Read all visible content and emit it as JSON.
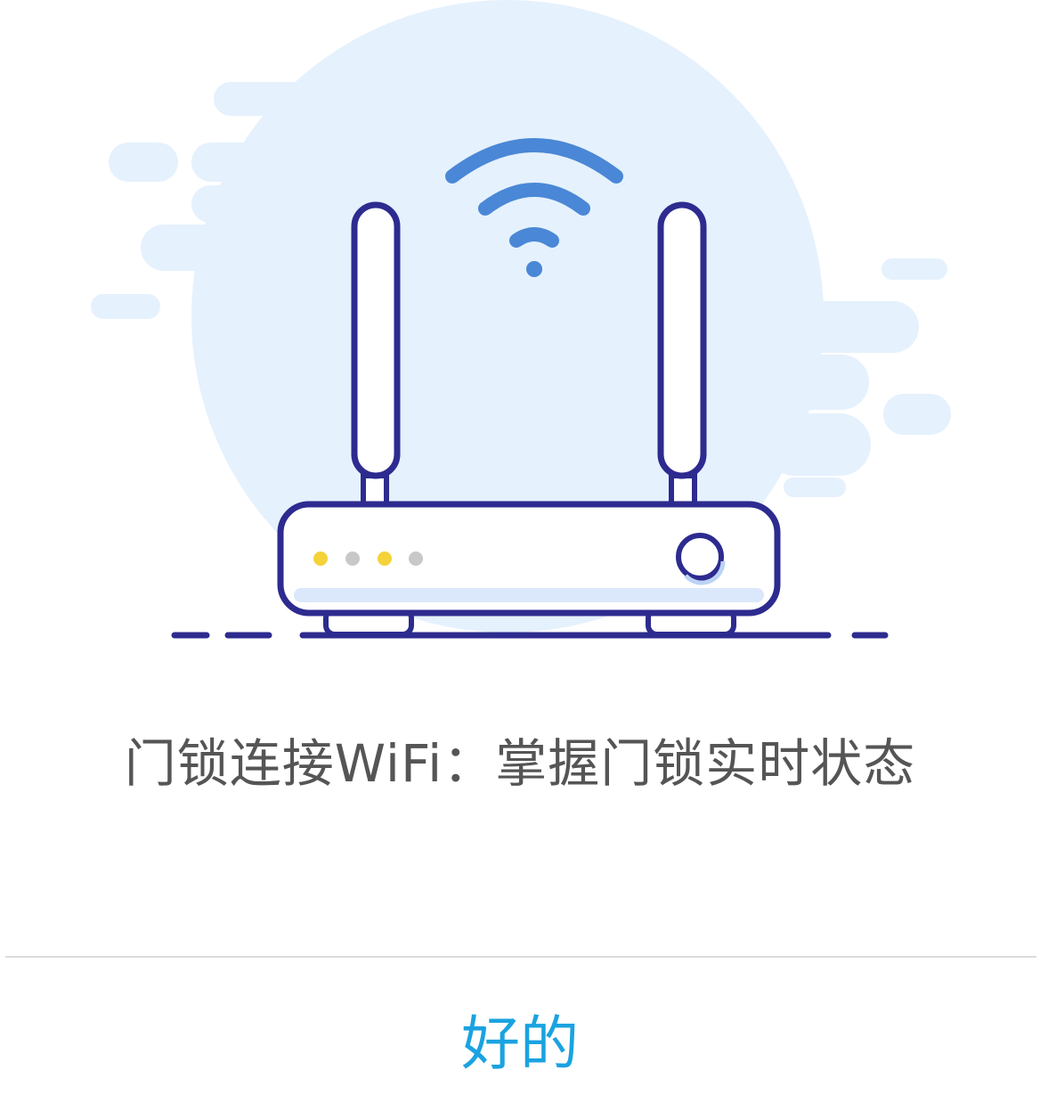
{
  "dialog": {
    "illustration": {
      "icon": "wifi-router-illustration",
      "background_color": "#e5f1fd",
      "router_outline_color": "#2d2b8f",
      "wifi_signal_color": "#4a87d6",
      "led_colors": [
        "#f4d23a",
        "#c8c8c8",
        "#f4d23a",
        "#c8c8c8"
      ]
    },
    "message": "门锁连接WiFi：掌握门锁实时状态",
    "ok_label": "好的",
    "accent_color": "#1aa3e0"
  }
}
